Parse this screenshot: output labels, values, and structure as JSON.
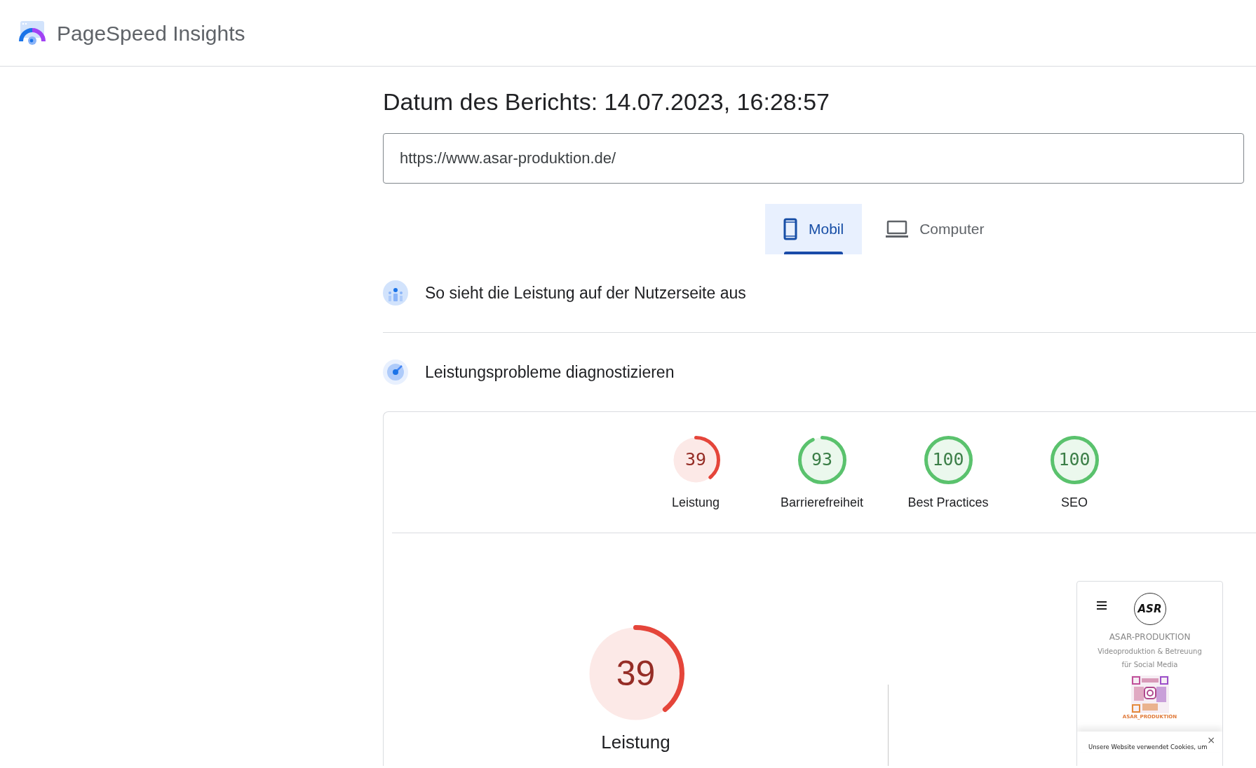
{
  "header": {
    "title": "PageSpeed Insights"
  },
  "report": {
    "date_label": "Datum des Berichts: 14.07.2023, 16:28:57",
    "url": "https://www.asar-produktion.de/"
  },
  "tabs": [
    {
      "label": "Mobil",
      "kind": "phone",
      "selected": true
    },
    {
      "label": "Computer",
      "kind": "laptop",
      "selected": false
    }
  ],
  "sections": [
    {
      "title": "So sieht die Leistung auf der Nutzerseite aus",
      "kind": "users"
    },
    {
      "title": "Leistungsprobleme diagnostizieren",
      "kind": "radar"
    }
  ],
  "scores": [
    {
      "score": "39",
      "label": "Leistung",
      "level": 0.39,
      "color": "#e5453a"
    },
    {
      "score": "93",
      "label": "Barrierefreiheit",
      "level": 0.93,
      "color": "#5ac26d"
    },
    {
      "score": "100",
      "label": "Best Practices",
      "level": 1,
      "color": "#5ac26d"
    },
    {
      "score": "100",
      "label": "SEO",
      "level": 1,
      "color": "#5ac26d"
    }
  ],
  "main_score": {
    "score": "39",
    "label": "Leistung",
    "level": 0.39,
    "color": "#e5453a"
  },
  "preview": {
    "logo_text": "ASR",
    "site_name": "ASAR-PRODUKTION",
    "tagline_1": "Videoproduktion & Betreuung",
    "tagline_2": "für Social Media",
    "qr_caption": "ASAR_PRODUKTION",
    "cookie_text": "Unsere Website verwendet Cookies, um",
    "close": "×"
  }
}
